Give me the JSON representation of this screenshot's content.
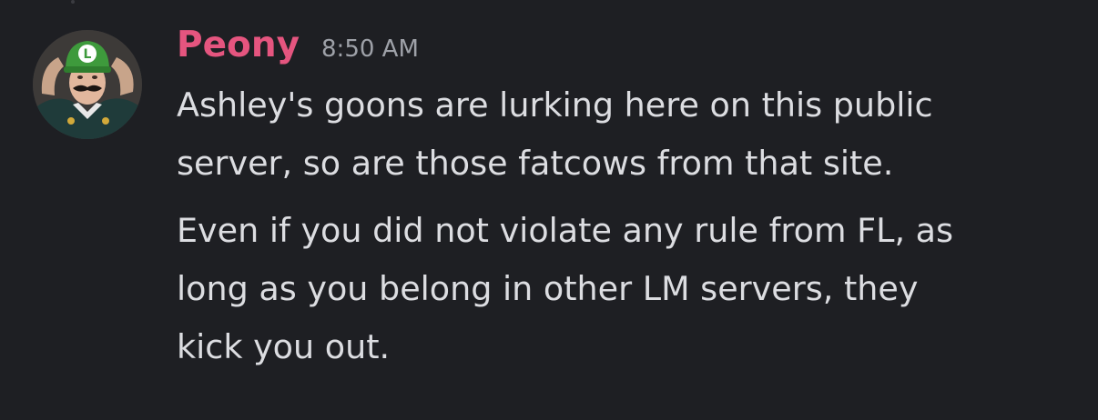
{
  "message": {
    "author": "Peony",
    "timestamp": "8:50 AM",
    "avatar_icon": "luigi-avatar-icon",
    "colors": {
      "background": "#1e1f23",
      "author": "#e5557f",
      "timestamp": "#9ea1a8",
      "text": "#dcdde1"
    },
    "paragraphs": [
      {
        "lines": [
          "Ashley's goons are lurking here on this public",
          "server, so are those fatcows from that site."
        ]
      },
      {
        "lines": [
          "Even if you did not violate any rule from FL, as",
          "long as you belong in other LM servers, they",
          "kick you out."
        ]
      }
    ]
  }
}
